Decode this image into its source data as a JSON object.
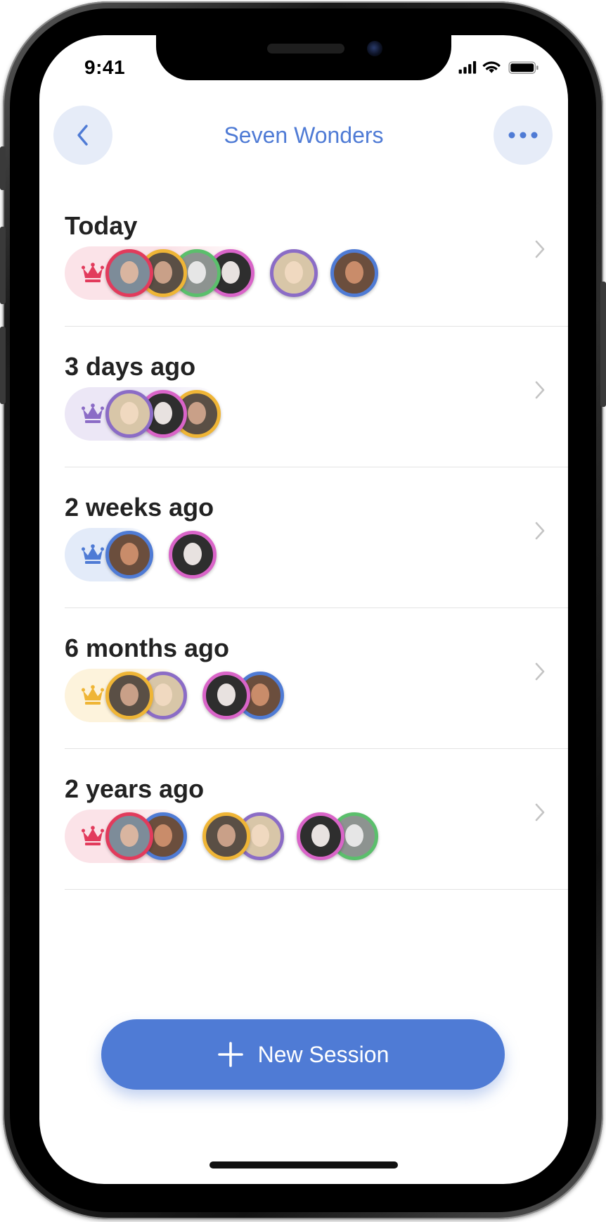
{
  "status_bar": {
    "time": "9:41"
  },
  "nav": {
    "title": "Seven Wonders",
    "back_icon": "chevron-left-icon",
    "more_icon": "ellipsis-icon"
  },
  "colors": {
    "accent": "#4f7bd5",
    "red": "#e23b5c",
    "yellow": "#efb536",
    "green": "#5bbf6c",
    "pink": "#d964c8",
    "purple": "#8b6cc6",
    "blue": "#4f7bd5"
  },
  "sessions": [
    {
      "label": "Today",
      "groups": [
        {
          "winner": true,
          "color": "red",
          "players": [
            "red",
            "yellow",
            "green",
            "pink"
          ]
        },
        {
          "winner": false,
          "players": [
            "purple"
          ]
        },
        {
          "winner": false,
          "players": [
            "blue"
          ]
        }
      ]
    },
    {
      "label": "3 days ago",
      "groups": [
        {
          "winner": true,
          "color": "purple",
          "players": [
            "purple",
            "pink",
            "yellow"
          ]
        }
      ]
    },
    {
      "label": "2 weeks ago",
      "groups": [
        {
          "winner": true,
          "color": "blue",
          "players": [
            "blue"
          ]
        },
        {
          "winner": false,
          "players": [
            "pink"
          ]
        }
      ]
    },
    {
      "label": "6 months ago",
      "groups": [
        {
          "winner": true,
          "color": "yellow",
          "players": [
            "yellow",
            "purple"
          ]
        },
        {
          "winner": false,
          "players": [
            "pink",
            "blue"
          ]
        }
      ]
    },
    {
      "label": "2 years ago",
      "groups": [
        {
          "winner": true,
          "color": "red",
          "players": [
            "red",
            "blue"
          ]
        },
        {
          "winner": false,
          "players": [
            "yellow",
            "purple"
          ]
        },
        {
          "winner": false,
          "players": [
            "pink",
            "green"
          ]
        }
      ]
    }
  ],
  "button": {
    "label": "New Session",
    "icon": "plus-icon"
  }
}
